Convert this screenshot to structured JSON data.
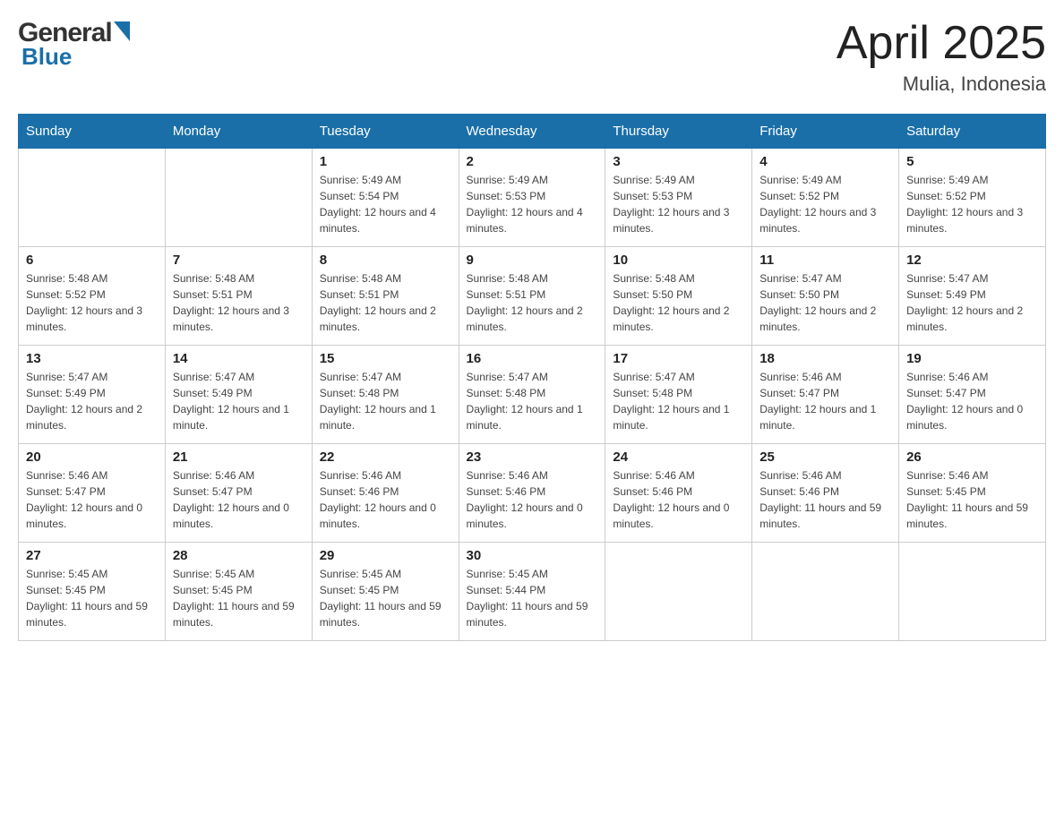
{
  "header": {
    "logo_general": "General",
    "logo_blue": "Blue",
    "month_title": "April 2025",
    "location": "Mulia, Indonesia"
  },
  "days_of_week": [
    "Sunday",
    "Monday",
    "Tuesday",
    "Wednesday",
    "Thursday",
    "Friday",
    "Saturday"
  ],
  "weeks": [
    [
      {
        "day": "",
        "info": ""
      },
      {
        "day": "",
        "info": ""
      },
      {
        "day": "1",
        "sunrise": "Sunrise: 5:49 AM",
        "sunset": "Sunset: 5:54 PM",
        "daylight": "Daylight: 12 hours and 4 minutes."
      },
      {
        "day": "2",
        "sunrise": "Sunrise: 5:49 AM",
        "sunset": "Sunset: 5:53 PM",
        "daylight": "Daylight: 12 hours and 4 minutes."
      },
      {
        "day": "3",
        "sunrise": "Sunrise: 5:49 AM",
        "sunset": "Sunset: 5:53 PM",
        "daylight": "Daylight: 12 hours and 3 minutes."
      },
      {
        "day": "4",
        "sunrise": "Sunrise: 5:49 AM",
        "sunset": "Sunset: 5:52 PM",
        "daylight": "Daylight: 12 hours and 3 minutes."
      },
      {
        "day": "5",
        "sunrise": "Sunrise: 5:49 AM",
        "sunset": "Sunset: 5:52 PM",
        "daylight": "Daylight: 12 hours and 3 minutes."
      }
    ],
    [
      {
        "day": "6",
        "sunrise": "Sunrise: 5:48 AM",
        "sunset": "Sunset: 5:52 PM",
        "daylight": "Daylight: 12 hours and 3 minutes."
      },
      {
        "day": "7",
        "sunrise": "Sunrise: 5:48 AM",
        "sunset": "Sunset: 5:51 PM",
        "daylight": "Daylight: 12 hours and 3 minutes."
      },
      {
        "day": "8",
        "sunrise": "Sunrise: 5:48 AM",
        "sunset": "Sunset: 5:51 PM",
        "daylight": "Daylight: 12 hours and 2 minutes."
      },
      {
        "day": "9",
        "sunrise": "Sunrise: 5:48 AM",
        "sunset": "Sunset: 5:51 PM",
        "daylight": "Daylight: 12 hours and 2 minutes."
      },
      {
        "day": "10",
        "sunrise": "Sunrise: 5:48 AM",
        "sunset": "Sunset: 5:50 PM",
        "daylight": "Daylight: 12 hours and 2 minutes."
      },
      {
        "day": "11",
        "sunrise": "Sunrise: 5:47 AM",
        "sunset": "Sunset: 5:50 PM",
        "daylight": "Daylight: 12 hours and 2 minutes."
      },
      {
        "day": "12",
        "sunrise": "Sunrise: 5:47 AM",
        "sunset": "Sunset: 5:49 PM",
        "daylight": "Daylight: 12 hours and 2 minutes."
      }
    ],
    [
      {
        "day": "13",
        "sunrise": "Sunrise: 5:47 AM",
        "sunset": "Sunset: 5:49 PM",
        "daylight": "Daylight: 12 hours and 2 minutes."
      },
      {
        "day": "14",
        "sunrise": "Sunrise: 5:47 AM",
        "sunset": "Sunset: 5:49 PM",
        "daylight": "Daylight: 12 hours and 1 minute."
      },
      {
        "day": "15",
        "sunrise": "Sunrise: 5:47 AM",
        "sunset": "Sunset: 5:48 PM",
        "daylight": "Daylight: 12 hours and 1 minute."
      },
      {
        "day": "16",
        "sunrise": "Sunrise: 5:47 AM",
        "sunset": "Sunset: 5:48 PM",
        "daylight": "Daylight: 12 hours and 1 minute."
      },
      {
        "day": "17",
        "sunrise": "Sunrise: 5:47 AM",
        "sunset": "Sunset: 5:48 PM",
        "daylight": "Daylight: 12 hours and 1 minute."
      },
      {
        "day": "18",
        "sunrise": "Sunrise: 5:46 AM",
        "sunset": "Sunset: 5:47 PM",
        "daylight": "Daylight: 12 hours and 1 minute."
      },
      {
        "day": "19",
        "sunrise": "Sunrise: 5:46 AM",
        "sunset": "Sunset: 5:47 PM",
        "daylight": "Daylight: 12 hours and 0 minutes."
      }
    ],
    [
      {
        "day": "20",
        "sunrise": "Sunrise: 5:46 AM",
        "sunset": "Sunset: 5:47 PM",
        "daylight": "Daylight: 12 hours and 0 minutes."
      },
      {
        "day": "21",
        "sunrise": "Sunrise: 5:46 AM",
        "sunset": "Sunset: 5:47 PM",
        "daylight": "Daylight: 12 hours and 0 minutes."
      },
      {
        "day": "22",
        "sunrise": "Sunrise: 5:46 AM",
        "sunset": "Sunset: 5:46 PM",
        "daylight": "Daylight: 12 hours and 0 minutes."
      },
      {
        "day": "23",
        "sunrise": "Sunrise: 5:46 AM",
        "sunset": "Sunset: 5:46 PM",
        "daylight": "Daylight: 12 hours and 0 minutes."
      },
      {
        "day": "24",
        "sunrise": "Sunrise: 5:46 AM",
        "sunset": "Sunset: 5:46 PM",
        "daylight": "Daylight: 12 hours and 0 minutes."
      },
      {
        "day": "25",
        "sunrise": "Sunrise: 5:46 AM",
        "sunset": "Sunset: 5:46 PM",
        "daylight": "Daylight: 11 hours and 59 minutes."
      },
      {
        "day": "26",
        "sunrise": "Sunrise: 5:46 AM",
        "sunset": "Sunset: 5:45 PM",
        "daylight": "Daylight: 11 hours and 59 minutes."
      }
    ],
    [
      {
        "day": "27",
        "sunrise": "Sunrise: 5:45 AM",
        "sunset": "Sunset: 5:45 PM",
        "daylight": "Daylight: 11 hours and 59 minutes."
      },
      {
        "day": "28",
        "sunrise": "Sunrise: 5:45 AM",
        "sunset": "Sunset: 5:45 PM",
        "daylight": "Daylight: 11 hours and 59 minutes."
      },
      {
        "day": "29",
        "sunrise": "Sunrise: 5:45 AM",
        "sunset": "Sunset: 5:45 PM",
        "daylight": "Daylight: 11 hours and 59 minutes."
      },
      {
        "day": "30",
        "sunrise": "Sunrise: 5:45 AM",
        "sunset": "Sunset: 5:44 PM",
        "daylight": "Daylight: 11 hours and 59 minutes."
      },
      {
        "day": "",
        "info": ""
      },
      {
        "day": "",
        "info": ""
      },
      {
        "day": "",
        "info": ""
      }
    ]
  ]
}
